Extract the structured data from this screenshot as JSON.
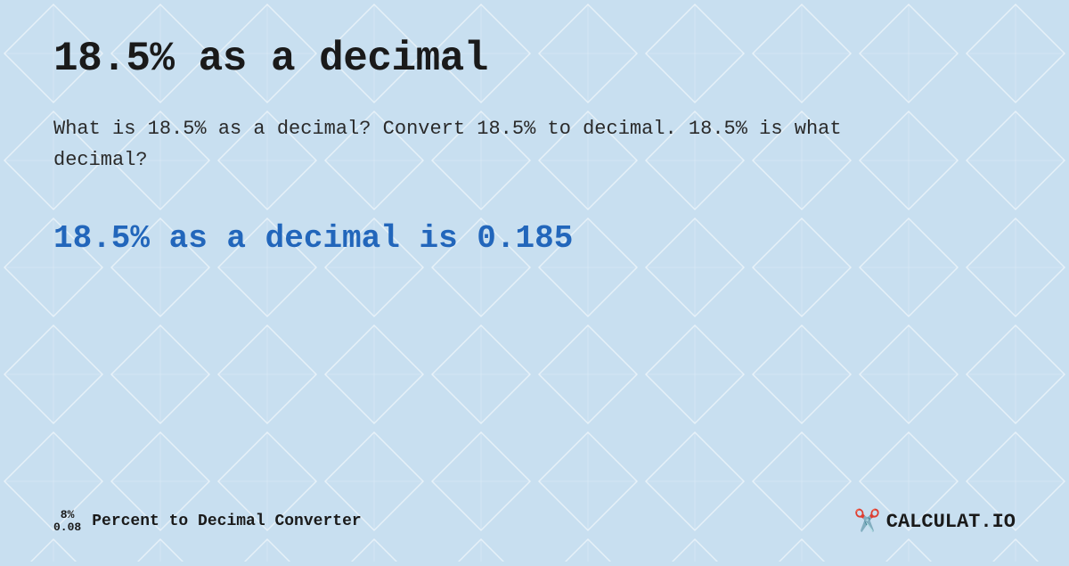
{
  "page": {
    "title": "18.5% as a decimal",
    "description": "What is 18.5% as a decimal? Convert 18.5% to decimal. 18.5% is what decimal?",
    "result": "18.5% as a decimal is 0.185",
    "footer": {
      "percent_top": "8%",
      "percent_bottom": "0.08",
      "converter_label": "Percent to Decimal Converter",
      "logo_text": "CALCULAT.IO"
    }
  }
}
